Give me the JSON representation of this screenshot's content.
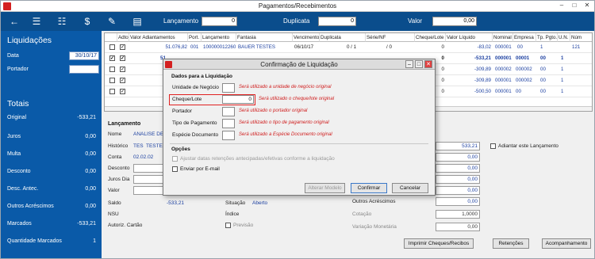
{
  "window": {
    "title": "Pagamentos/Recebimentos"
  },
  "toolbar": {
    "lancamento_label": "Lançamento",
    "lancamento_value": "0",
    "duplicata_label": "Duplicata",
    "duplicata_value": "0",
    "valor_label": "Valor",
    "valor_value": "0,00",
    "icons": [
      "back-arrow-icon",
      "list-check-icon",
      "list-cancel-icon",
      "currency-icon",
      "pencil-icon",
      "money-stack-icon"
    ]
  },
  "sidebar": {
    "title": "Liquidações",
    "data_label": "Data",
    "data_value": "30/10/17",
    "portador_label": "Portador",
    "portador_value": "",
    "totais_title": "Totais",
    "totals": [
      {
        "label": "Original",
        "value": "-533,21"
      },
      {
        "label": "Juros",
        "value": "0,00"
      },
      {
        "label": "Multa",
        "value": "0,00"
      },
      {
        "label": "Desconto",
        "value": "0,00"
      },
      {
        "label": "Desc. Antec.",
        "value": "0,00"
      },
      {
        "label": "Outros Acréscimos",
        "value": "0,00"
      },
      {
        "label": "Marcados",
        "value": "-533,21"
      },
      {
        "label": "Quantidade Marcados",
        "value": "1"
      }
    ]
  },
  "grid": {
    "headers": [
      "Adto.",
      "Valor Adiantamentos",
      "Port.",
      "Lançamento",
      "Fantasia",
      "Vencimento",
      "Duplicata",
      "Série/NF",
      "Cheque/Lote",
      "Valor Líquido",
      "Nominal",
      "Empresa",
      "Tp. Pgto.",
      "U.N.",
      "Núm"
    ],
    "rows": [
      {
        "adiant": "51.076,82",
        "port": "001",
        "lanc": "100000012260",
        "fantasia": "BAUER TESTES",
        "venc": "06/10/17",
        "dup": "0 / 1",
        "serie": "/ 0",
        "cheque": "0",
        "liquido": "-83,02",
        "nominal": "000001",
        "empresa": "00",
        "tp": "1",
        "un": "121"
      },
      {
        "adiant": "51",
        "port": "",
        "lanc": "",
        "fantasia": "",
        "venc": "",
        "dup": "",
        "serie": "",
        "cheque": "0",
        "liquido": "-533,21",
        "nominal": "000001",
        "empresa": "00001",
        "tp": "00",
        "un": "1"
      },
      {
        "adiant": "",
        "port": "",
        "lanc": "",
        "fantasia": "",
        "venc": "",
        "dup": "",
        "serie": "",
        "cheque": "0",
        "liquido": "-309,89",
        "nominal": "000002",
        "empresa": "000002",
        "tp": "00",
        "un": "1"
      },
      {
        "adiant": "",
        "port": "",
        "lanc": "",
        "fantasia": "",
        "venc": "",
        "dup": "",
        "serie": "",
        "cheque": "0",
        "liquido": "-309,89",
        "nominal": "000001",
        "empresa": "000002",
        "tp": "00",
        "un": "1"
      },
      {
        "adiant": "",
        "port": "",
        "lanc": "",
        "fantasia": "",
        "venc": "",
        "dup": "",
        "serie": "",
        "cheque": "0",
        "liquido": "-500,50",
        "nominal": "000001",
        "empresa": "00",
        "tp": "00",
        "un": "1"
      }
    ]
  },
  "lancamento": {
    "title": "Lançamento",
    "nome_label": "Nome",
    "nome_value": "ANALISE DE TR",
    "historico_label": "Histórico",
    "historico_code": "TES",
    "historico_value": "TESTE",
    "conta_label": "Conta",
    "conta_value": "02.02.02",
    "desconto_label": "Desconto",
    "juros_label": "Juros Dia",
    "valor_label": "Valor",
    "saldo_label": "Saldo",
    "saldo_value": "-533,21",
    "nsu_label": "NSU",
    "autoriz_label": "Autoriz. Cartão",
    "situacao_label": "Situação",
    "situacao_value": "Aberto",
    "indice_label": "Índice",
    "previsao_label": "Previsão",
    "right_value": "533,21",
    "right_values": [
      "0,00",
      "0,00",
      "0,00",
      "0,00"
    ],
    "adiantar_label": "Adiantar este Lançamento",
    "outros_label": "Outros Acréscimos",
    "outros_value": "0,00",
    "cotacao_label": "Cotação",
    "cotacao_value": "1,0000",
    "variacao_label": "Variação Monetária",
    "variacao_value": "0,00"
  },
  "buttons": {
    "imprimir": "Imprimir Cheques/Recibos",
    "retencoes": "Retenções",
    "acompanhamento": "Acompanhamento"
  },
  "dialog": {
    "title": "Confirmação de Liquidação",
    "section": "Dados para a Liquidação",
    "fields": [
      {
        "label": "Unidade de Negócio",
        "value": "",
        "hint": "Será utilizado a unidade de negócio original"
      },
      {
        "label": "Cheque/Lote",
        "value": "0",
        "hint": "Será utilizado o cheque/lote original"
      },
      {
        "label": "Portador",
        "value": "",
        "hint": "Será utilizado o portador original"
      },
      {
        "label": "Tipo de Pagamento",
        "value": "",
        "hint": "Será utilizado o tipo de pagamento original"
      },
      {
        "label": "Espécie Documento",
        "value": "",
        "hint": "Será utilizado a Espécie Documento original"
      }
    ],
    "opcoes_title": "Opções",
    "opt1": "Ajustar datas retenções antecipadas/efetivas conforme a liquidação",
    "opt2": "Enviar por E-mail",
    "btn_alterar": "Alterar Modelo",
    "btn_confirmar": "Confirmar",
    "btn_cancelar": "Cancelar",
    "highlight_color": "#e02020"
  }
}
